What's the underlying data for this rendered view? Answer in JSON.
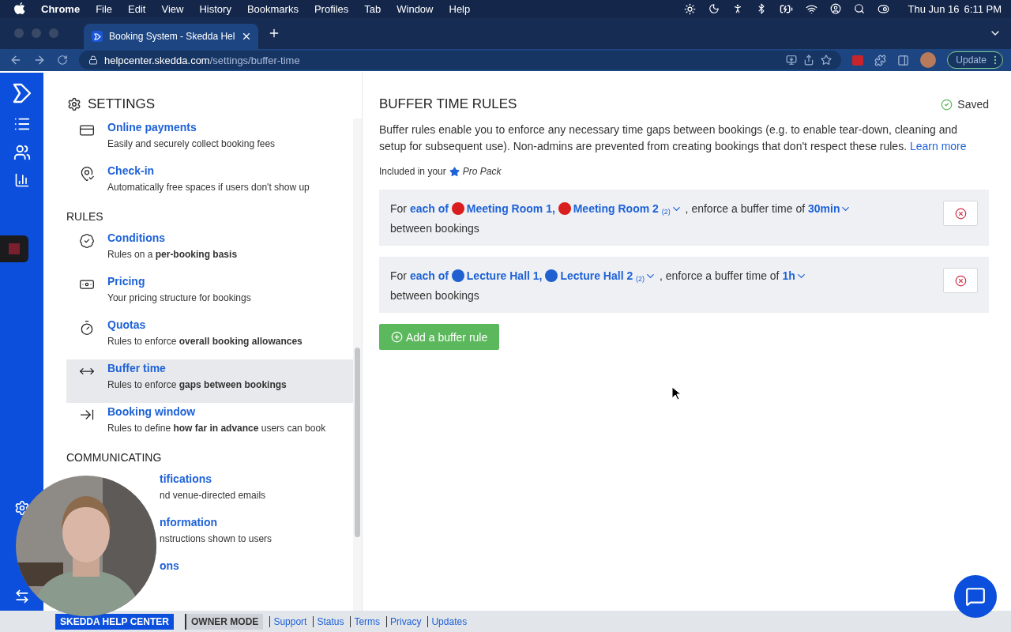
{
  "menubar": {
    "app": "Chrome",
    "items": [
      "File",
      "Edit",
      "View",
      "History",
      "Bookmarks",
      "Profiles",
      "Tab",
      "Window",
      "Help"
    ],
    "date": "Thu Jun 16",
    "time": "6:11 PM"
  },
  "browser": {
    "tab": {
      "title": "Booking System - Skedda Hel",
      "selected": true
    },
    "url": {
      "host": "helpcenter.skedda.com",
      "path": "/settings/buffer-time"
    },
    "update_button": "Update"
  },
  "settings": {
    "title": "SETTINGS",
    "sections": [
      {
        "items": [
          {
            "kind": "link",
            "title": "Online payments",
            "description": "Easily and securely collect booking fees",
            "selected": false
          },
          {
            "kind": "link",
            "title": "Check-in",
            "description": "Automatically free spaces if users don't show up",
            "selected": false
          }
        ]
      },
      {
        "heading": "RULES",
        "items": [
          {
            "kind": "link",
            "title": "Conditions",
            "description": "Rules on a **per-booking basis**",
            "selected": false
          },
          {
            "kind": "link",
            "title": "Pricing",
            "description": "Your pricing structure for bookings",
            "selected": false
          },
          {
            "kind": "link",
            "title": "Quotas",
            "description": "Rules to enforce **overall booking allowances**",
            "selected": false
          },
          {
            "kind": "link",
            "title": "Buffer time",
            "description": "Rules to enforce **gaps between bookings**",
            "selected": true
          },
          {
            "kind": "link",
            "title": "Booking window",
            "description": "Rules to define **how far in advance** users can book",
            "selected": false
          }
        ]
      },
      {
        "heading": "COMMUNICATING",
        "items": [
          {
            "kind": "covered",
            "title": "tifications",
            "description": "nd venue-directed emails",
            "selected": false
          },
          {
            "kind": "covered",
            "title": "nformation",
            "description": "nstructions shown to users",
            "selected": false
          },
          {
            "kind": "covered",
            "title": "ons",
            "selected": false
          }
        ]
      }
    ]
  },
  "main": {
    "title": "BUFFER TIME RULES",
    "status": "Saved",
    "description": "Buffer rules enable you to enforce any necessary time gaps between bookings (e.g. to enable tear-down, cleaning and setup for subsequent use). Non-admins are prevented from creating bookings that don't respect these rules.",
    "learn_more": "Learn more",
    "included_label": "Included in your",
    "plan": "Pro Pack",
    "rules": [
      {
        "prefix": "For",
        "scope": "each of",
        "spaces": [
          {
            "label": "Meeting Room 1,",
            "color": "#d81e1e"
          },
          {
            "label": "Meeting Room 2",
            "color": "#d81e1e"
          }
        ],
        "count": "(2)",
        "middle": ", enforce a buffer time of",
        "duration": "30min",
        "suffix": "between bookings"
      },
      {
        "prefix": "For",
        "scope": "each of",
        "spaces": [
          {
            "label": "Lecture Hall 1,",
            "color": "#1f5fd0"
          },
          {
            "label": "Lecture Hall 2",
            "color": "#1f5fd0"
          }
        ],
        "count": "(2)",
        "middle": ", enforce a buffer time of",
        "duration": "1h",
        "suffix": "between bookings"
      }
    ],
    "add_button": "Add a buffer rule"
  },
  "footer": {
    "brand": "SKEDDA HELP CENTER",
    "mode": "OWNER MODE",
    "links": [
      "Support",
      "Status",
      "Terms",
      "Privacy",
      "Updates"
    ]
  }
}
